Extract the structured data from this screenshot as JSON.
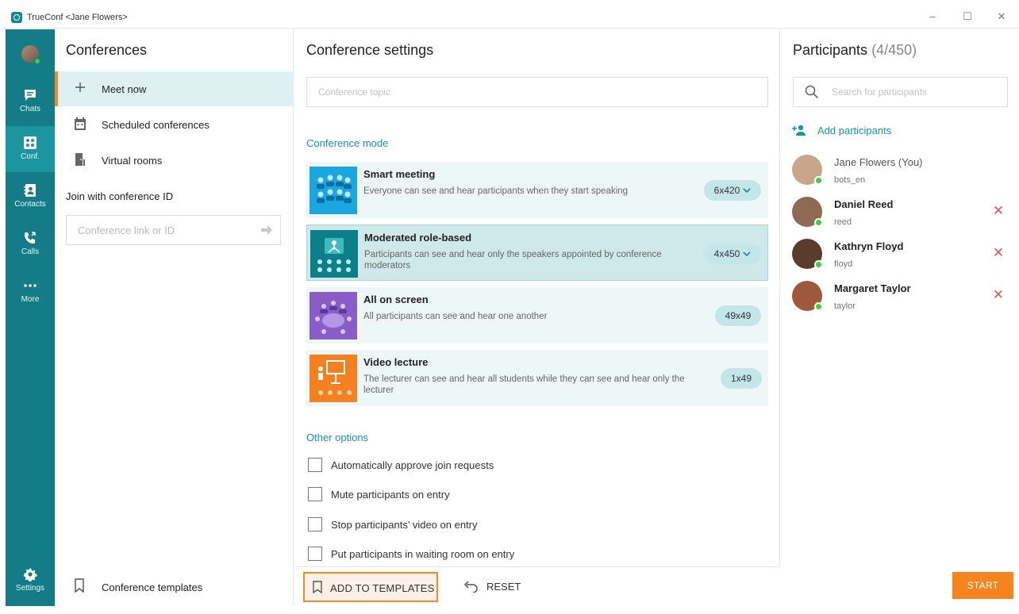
{
  "window": {
    "title": "TrueConf <Jane Flowers>",
    "minimize_glyph": "–",
    "maximize_glyph": "☐",
    "close_glyph": "✕"
  },
  "nav": {
    "items": [
      {
        "label": "Chats",
        "icon": "chat-icon"
      },
      {
        "label": "Conf.",
        "icon": "conference-icon"
      },
      {
        "label": "Contacts",
        "icon": "contacts-icon"
      },
      {
        "label": "Calls",
        "icon": "calls-icon"
      },
      {
        "label": "More",
        "icon": "more-icon"
      },
      {
        "label": "Settings",
        "icon": "gear-icon"
      }
    ],
    "active": "Conf."
  },
  "conferences": {
    "title": "Conferences",
    "items": [
      {
        "label": "Meet now",
        "icon": "plus-icon"
      },
      {
        "label": "Scheduled conferences",
        "icon": "calendar-icon"
      },
      {
        "label": "Virtual rooms",
        "icon": "door-icon"
      }
    ],
    "join_title": "Join with conference ID",
    "join_placeholder": "Conference link or ID",
    "templates_label": "Conference templates"
  },
  "settings": {
    "title": "Conference settings",
    "topic_placeholder": "Conference topic",
    "mode_section": "Conference mode",
    "modes": [
      {
        "name": "Smart meeting",
        "description": "Everyone can see and hear participants when they start speaking",
        "size": "6x420",
        "has_dropdown": true,
        "selected": false
      },
      {
        "name": "Moderated role-based",
        "description": "Participants can see and hear only the speakers appointed by conference moderators",
        "size": "4x450",
        "has_dropdown": true,
        "selected": true
      },
      {
        "name": "All on screen",
        "description": "All participants can see and hear one another",
        "size": "49x49",
        "has_dropdown": false,
        "selected": false
      },
      {
        "name": "Video lecture",
        "description": "The lecturer can see and hear all students while they can see and hear only the lecturer",
        "size": "1x49",
        "has_dropdown": false,
        "selected": false
      }
    ],
    "options_section": "Other options",
    "options": [
      {
        "label": "Automatically approve join requests",
        "checked": false
      },
      {
        "label": "Mute participants on entry",
        "checked": false
      },
      {
        "label": "Stop participants’ video on entry",
        "checked": false
      },
      {
        "label": "Put participants in waiting room on entry",
        "checked": false
      }
    ],
    "add_templates_label": "ADD TO TEMPLATES",
    "reset_label": "RESET"
  },
  "participants": {
    "title": "Participants",
    "count": "(4/450)",
    "search_placeholder": "Search for participants",
    "add_label": "Add participants",
    "list": [
      {
        "name": "Jane Flowers (You)",
        "login": "bots_en",
        "removable": false,
        "avatar_color": "#c9a58a"
      },
      {
        "name": "Daniel Reed",
        "login": "reed",
        "removable": true,
        "avatar_color": "#8f6a52"
      },
      {
        "name": "Kathryn Floyd",
        "login": "floyd",
        "removable": true,
        "avatar_color": "#5a3b2c"
      },
      {
        "name": "Margaret Taylor",
        "login": "taylor",
        "removable": true,
        "avatar_color": "#a0583a"
      }
    ],
    "start_label": "START"
  },
  "colors": {
    "accent_teal": "#147c86",
    "accent_orange": "#f28a2a",
    "online_green": "#3dd13d",
    "remove_red": "#e25555"
  }
}
